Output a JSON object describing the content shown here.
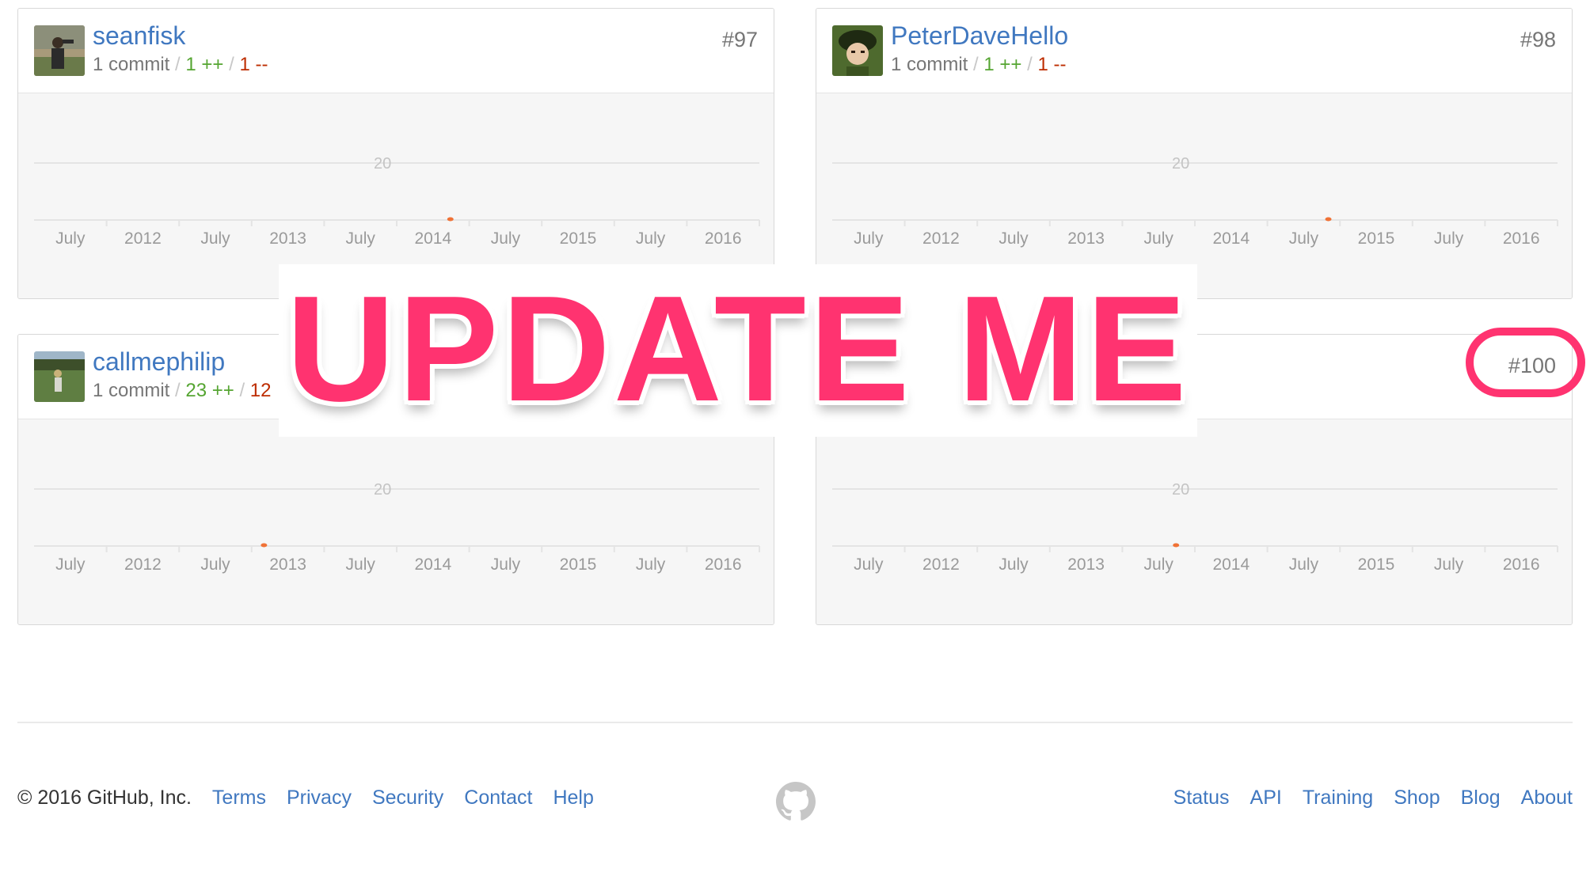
{
  "contributors": [
    {
      "username": "seanfisk",
      "commits": "1 commit",
      "additions": "1 ++",
      "deletions": "1 --",
      "rank": "#97",
      "avatar_colors": [
        "#6a7a4a",
        "#2b2b2b",
        "#a89a7a"
      ],
      "chart_data": {
        "type": "area",
        "y_tick_label": "20",
        "x_tick_labels": [
          "July",
          "2012",
          "July",
          "2013",
          "July",
          "2014",
          "July",
          "2015",
          "July",
          "2016"
        ],
        "peak_marker_period": "between 2014 and July"
      }
    },
    {
      "username": "PeterDaveHello",
      "commits": "1 commit",
      "additions": "1 ++",
      "deletions": "1 --",
      "rank": "#98",
      "avatar_colors": [
        "#4e6a2e",
        "#e8c8a8",
        "#1f2a12"
      ],
      "chart_data": {
        "type": "area",
        "y_tick_label": "20",
        "x_tick_labels": [
          "July",
          "2012",
          "July",
          "2013",
          "July",
          "2014",
          "July",
          "2015",
          "July",
          "2016"
        ],
        "peak_marker_period": "between July and 2015"
      }
    },
    {
      "username": "callmephilip",
      "commits": "1 commit",
      "additions": "23 ++",
      "deletions": "12",
      "rank": "",
      "avatar_colors": [
        "#5f7e42",
        "#c9b27a",
        "#3d4f2a"
      ],
      "chart_data": {
        "type": "area",
        "y_tick_label": "20",
        "x_tick_labels": [
          "July",
          "2012",
          "July",
          "2013",
          "July",
          "2014",
          "July",
          "2015",
          "July",
          "2016"
        ],
        "peak_marker_period": "just before 2013"
      }
    },
    {
      "username": "",
      "commits": "",
      "additions": "",
      "deletions": "",
      "rank": "#100",
      "avatar_colors": [],
      "chart_data": {
        "type": "area",
        "y_tick_label": "20",
        "x_tick_labels": [
          "July",
          "2012",
          "July",
          "2013",
          "July",
          "2014",
          "July",
          "2015",
          "July",
          "2016"
        ],
        "peak_marker_period": "between July and 2014"
      }
    }
  ],
  "overlay": {
    "text": "UPDATE ME",
    "color": "#ff3370",
    "highlighted_item": "#100"
  },
  "footer": {
    "copyright": "© 2016 GitHub, Inc.",
    "left_links": [
      "Terms",
      "Privacy",
      "Security",
      "Contact",
      "Help"
    ],
    "center_icon": "github-octocat-icon",
    "right_links": [
      "Status",
      "API",
      "Training",
      "Shop",
      "Blog",
      "About"
    ]
  },
  "colors": {
    "link": "#4078c0",
    "additions": "#55a532",
    "deletions": "#bd2c00",
    "marker": "#f07236"
  }
}
